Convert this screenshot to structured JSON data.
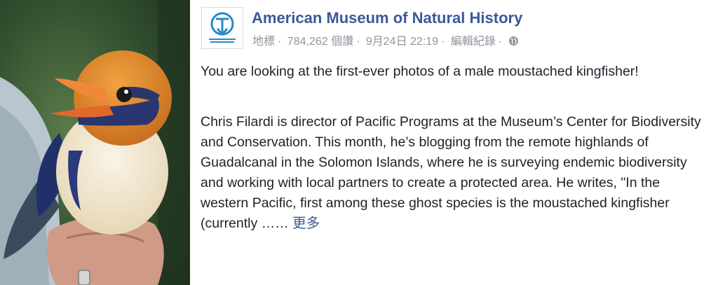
{
  "post": {
    "page_name": "American Museum of Natural History",
    "meta": {
      "tag": "地標",
      "views": "784,262 個讚",
      "date": "9月24日 22:19",
      "edit_history": "編輯紀錄",
      "privacy_icon": "globe-icon"
    },
    "paragraphs": [
      "You are looking at the first-ever photos of a male moustached kingfisher!",
      "Chris Filardi is director of Pacific Programs at the Museum’s Center for Biodiversity and Conservation. This month, he’s blogging from the remote highlands of Guadalcanal in the Solomon Islands, where he is surveying endemic biodiversity and working with local partners to create a protected area. He writes, \"In the western Pacific, first among these ghost species is the moustached kingfisher (currently"
    ],
    "ellipsis": "……",
    "see_more": "更多"
  },
  "colors": {
    "link_blue": "#3b5998",
    "meta_gray": "#90949c",
    "text": "#1d2129"
  }
}
